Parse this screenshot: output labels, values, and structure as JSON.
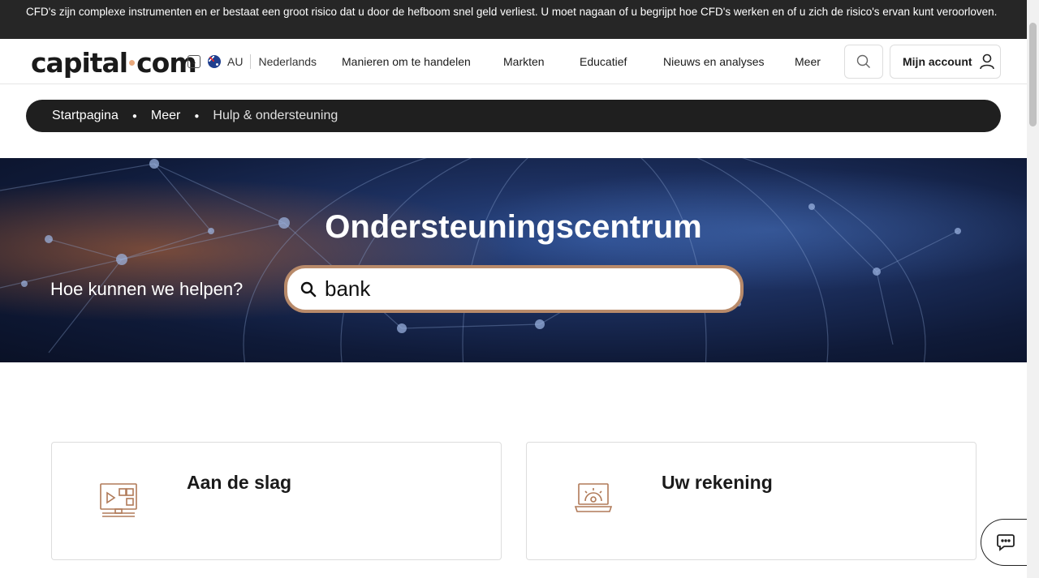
{
  "risk_banner": "CFD's zijn complexe instrumenten en er bestaat een groot risico dat u door de hefboom snel geld verliest. U moet nagaan of u begrijpt hoe CFD's werken en of u zich de risico's ervan kunt veroorloven.",
  "header": {
    "logo_left": "capital",
    "logo_right": "com",
    "region": {
      "code": "AU",
      "flag_icon": "australia-flag-icon",
      "language": "Nederlands"
    },
    "nav": [
      "Manieren om te handelen",
      "Markten",
      "Educatief",
      "Nieuws en analyses",
      "Meer"
    ],
    "account_label": "Mijn account"
  },
  "breadcrumb": [
    "Startpagina",
    "Meer",
    "Hulp & ondersteuning"
  ],
  "hero": {
    "title": "Ondersteuningscentrum",
    "ask": "Hoe kunnen we helpen?",
    "search_value": "bank"
  },
  "cards": [
    {
      "title": "Aan de slag",
      "icon": "video-screen-icon"
    },
    {
      "title": "Uw rekening",
      "icon": "laptop-gear-icon"
    }
  ],
  "colors": {
    "accent": "#b88a6a",
    "dark": "#1f1f1f"
  }
}
